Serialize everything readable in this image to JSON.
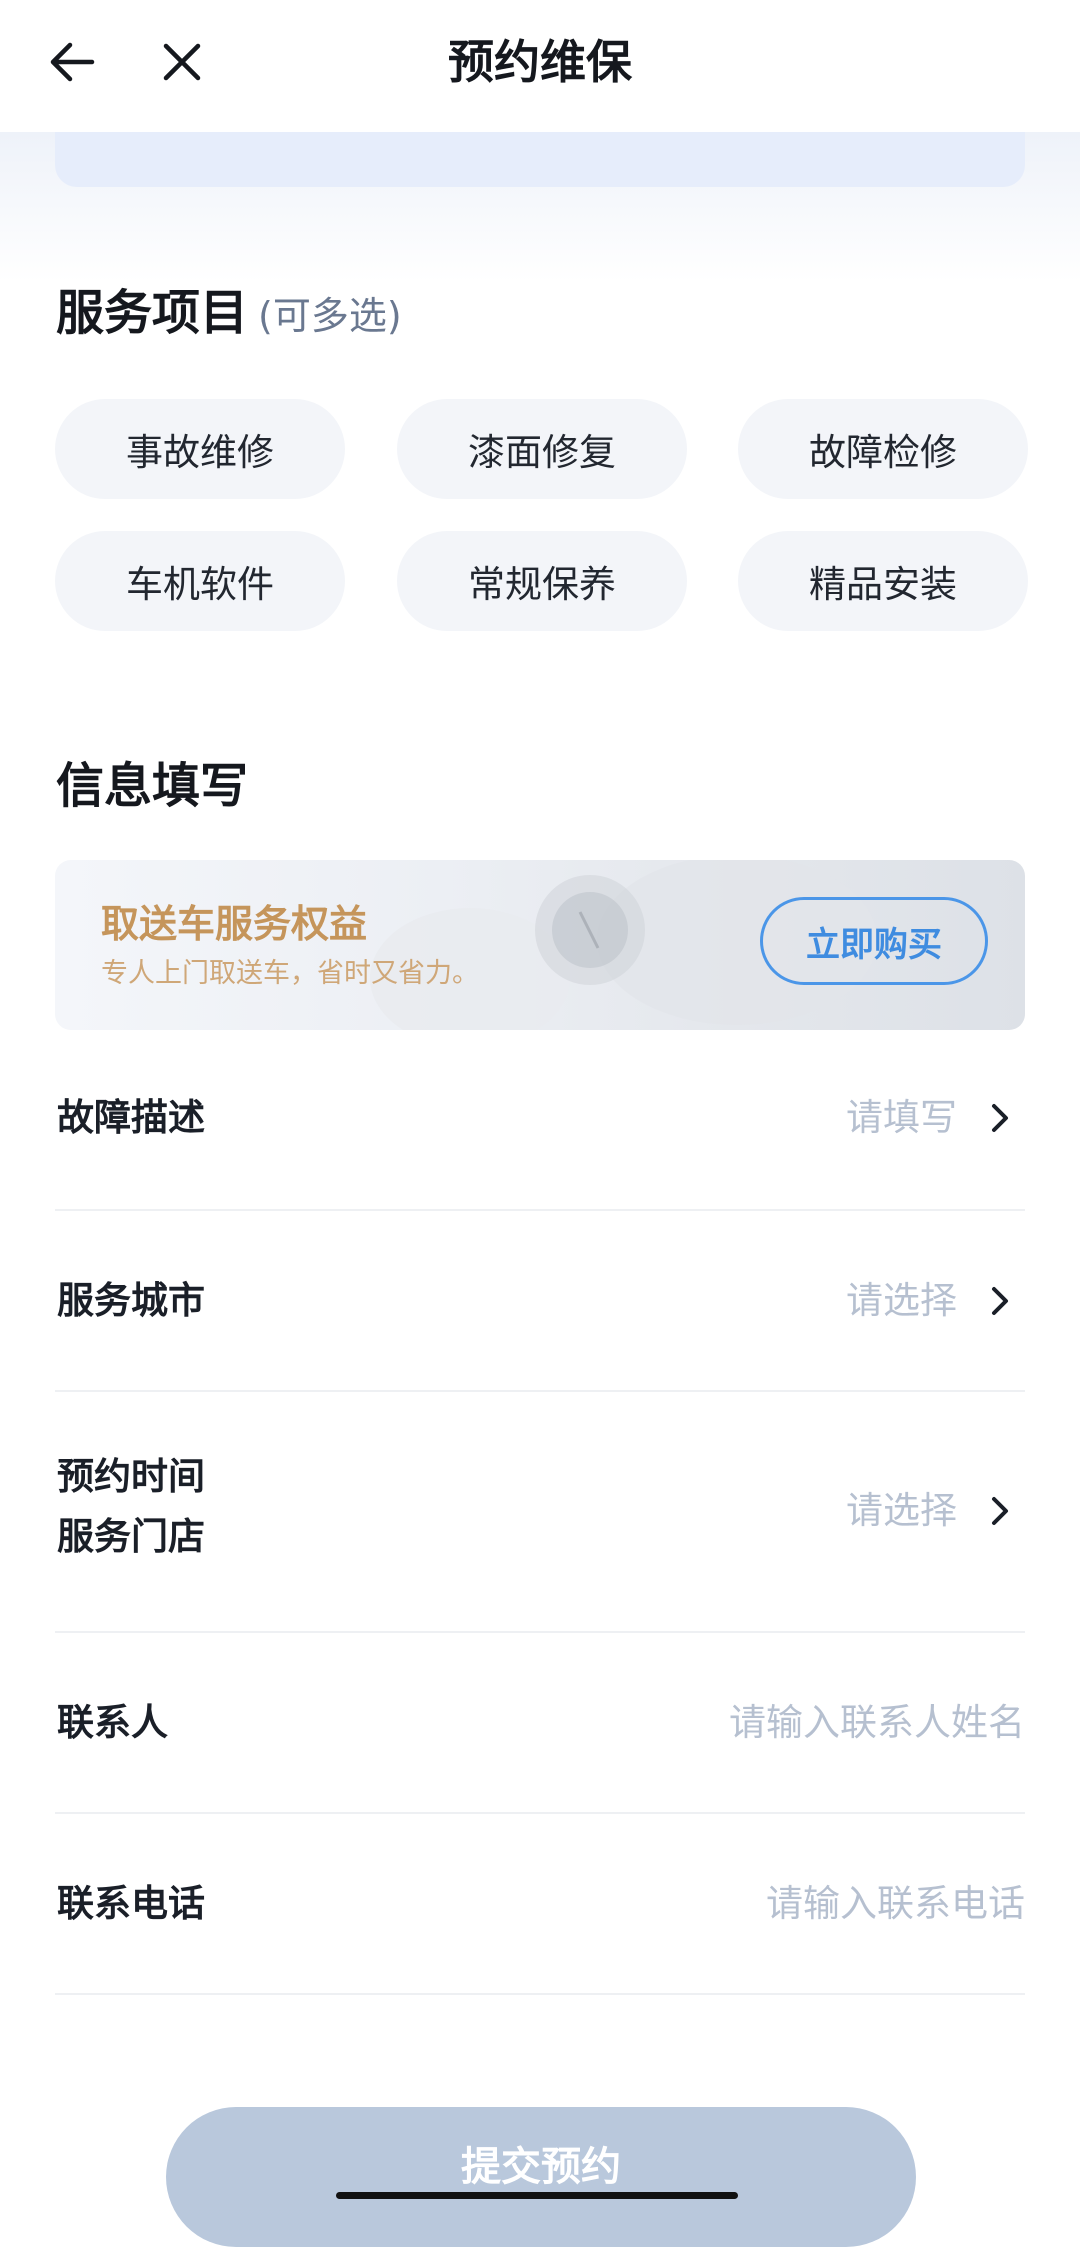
{
  "header": {
    "title": "预约维保",
    "back_icon": "arrow-left-icon",
    "close_icon": "close-icon"
  },
  "service_section": {
    "title": "服务项目",
    "subtitle": "(可多选)",
    "options": [
      "事故维修",
      "漆面修复",
      "故障检修",
      "车机软件",
      "常规保养",
      "精品安装"
    ]
  },
  "info_section": {
    "title": "信息填写"
  },
  "promo": {
    "title": "取送车服务权益",
    "subtitle": "专人上门取送车，省时又省力。",
    "button_label": "立即购买",
    "title_color": "#c5955b",
    "button_color": "#3f8ce0"
  },
  "form": {
    "fault": {
      "label": "故障描述",
      "placeholder": "请填写"
    },
    "city": {
      "label": "服务城市",
      "placeholder": "请选择"
    },
    "time_store": {
      "label_line1": "预约时间",
      "label_line2": "服务门店",
      "placeholder": "请选择"
    },
    "contact": {
      "label": "联系人",
      "placeholder": "请输入联系人姓名"
    },
    "phone": {
      "label": "联系电话",
      "placeholder": "请输入联系电话"
    }
  },
  "submit": {
    "label": "提交预约",
    "color": "#b9c8dc"
  }
}
